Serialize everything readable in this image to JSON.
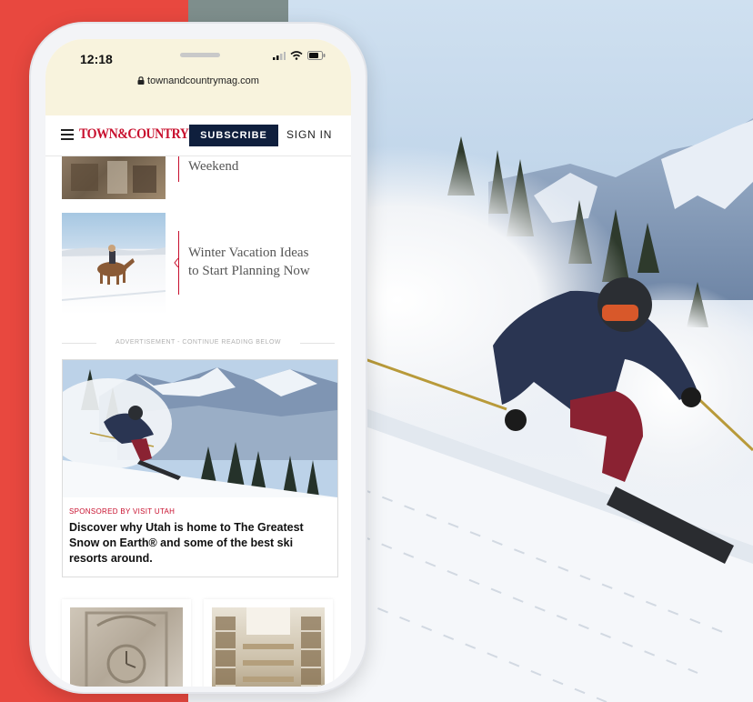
{
  "status_bar": {
    "time": "12:18",
    "url": "townandcountrymag.com"
  },
  "nav": {
    "logo": "TOWN&COUNTRY",
    "subscribe_label": "SUBSCRIBE",
    "signin_label": "SIGN IN"
  },
  "stories": [
    {
      "title_lines": [
        "Weekend"
      ],
      "image": "dining-room-photo"
    },
    {
      "title_lines": [
        "Winter Vacation Ideas",
        "to Start Planning Now"
      ],
      "image": "horse-rider-snow-photo"
    }
  ],
  "ad": {
    "label": "ADVERTISEMENT - CONTINUE READING BELOW",
    "sponsor": "SPONSORED BY VISIT UTAH",
    "headline_lines": [
      "Discover why Utah is home to The Greatest",
      "Snow on Earth® and some of the best ski",
      "resorts around."
    ],
    "image": "skier-mountains-photo"
  },
  "grid_images": [
    "ornate-clock-photo",
    "library-interior-photo"
  ],
  "colors": {
    "brand_red": "#c8102e",
    "subscribe_bg": "#0f1f3d",
    "background_red": "#e8483f"
  }
}
